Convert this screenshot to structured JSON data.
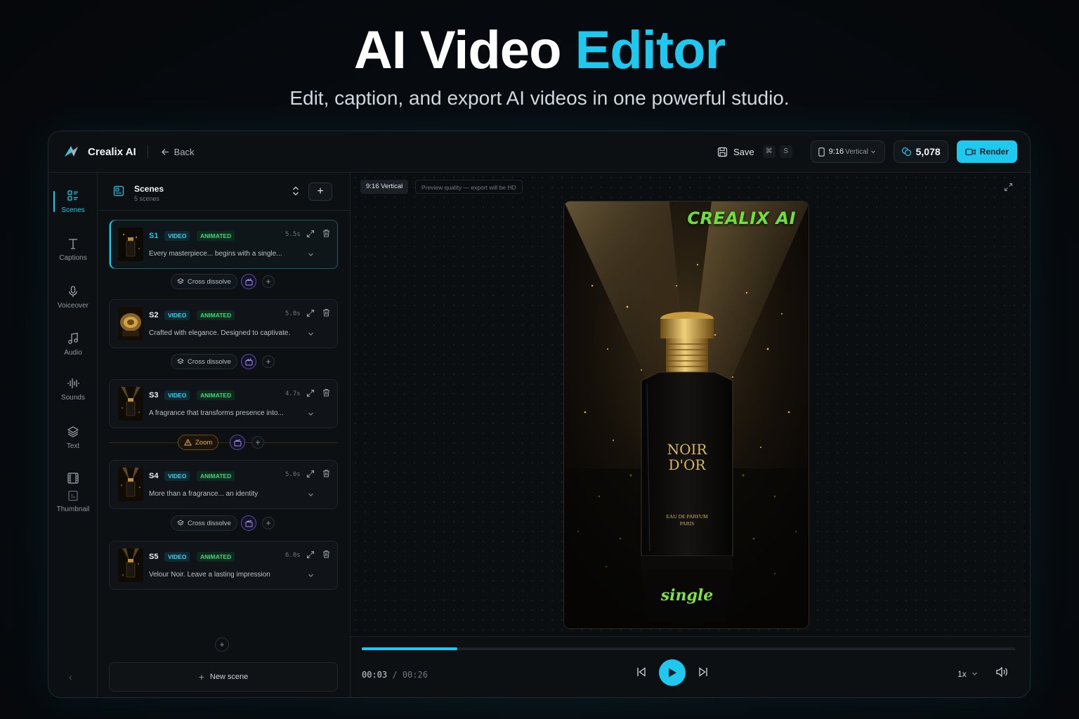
{
  "hero": {
    "title_main": "AI Video",
    "title_accent": "Editor",
    "subtitle": "Edit, caption, and export AI videos in one powerful studio."
  },
  "header": {
    "brand": "Crealix AI",
    "back": "Back",
    "save": "Save",
    "save_shortcut_mod": "⌘",
    "save_shortcut_key": "S",
    "aspect_ratio_value": "9:16",
    "aspect_ratio_label": "Vertical",
    "credits": "5,078",
    "render": "Render"
  },
  "rail": [
    {
      "label": "Scenes",
      "icon": "scenes-icon",
      "active": true
    },
    {
      "label": "Captions",
      "icon": "text-t-icon"
    },
    {
      "label": "Voiceover",
      "icon": "microphone-icon"
    },
    {
      "label": "Audio",
      "icon": "music-note-icon"
    },
    {
      "label": "Sounds",
      "icon": "waveform-icon"
    },
    {
      "label": "Text",
      "icon": "layers-icon"
    },
    {
      "label": "Thumbnail",
      "icon": "film-icon"
    }
  ],
  "scenes_panel": {
    "title": "Scenes",
    "count": "5 scenes",
    "scenes": [
      {
        "id": "S1",
        "tag_type": "VIDEO",
        "tag_status": "ANIMATED",
        "duration": "5.5s",
        "text": "Every masterpiece... begins with a single...",
        "active": true
      },
      {
        "id": "S2",
        "tag_type": "VIDEO",
        "tag_status": "ANIMATED",
        "duration": "5.0s",
        "text": "Crafted with elegance. Designed to captivate."
      },
      {
        "id": "S3",
        "tag_type": "VIDEO",
        "tag_status": "ANIMATED",
        "duration": "4.7s",
        "text": "A fragrance that transforms presence into..."
      },
      {
        "id": "S4",
        "tag_type": "VIDEO",
        "tag_status": "ANIMATED",
        "duration": "5.0s",
        "text": "More than a fragrance... an identity"
      },
      {
        "id": "S5",
        "tag_type": "VIDEO",
        "tag_status": "ANIMATED",
        "duration": "6.0s",
        "text": "Velour Noir. Leave a lasting impression"
      }
    ],
    "transitions": [
      {
        "label": "Cross dissolve",
        "warning": false
      },
      {
        "label": "Cross dissolve",
        "warning": false
      },
      {
        "label": "Zoom",
        "warning": true
      },
      {
        "label": "Cross dissolve",
        "warning": false
      }
    ],
    "new_scene": "New scene"
  },
  "preview": {
    "ratio_chip": "9:16 Vertical",
    "quality_chip": "Preview quality — export will be HD",
    "overlay_brand": "CREALIX AI",
    "overlay_caption": "single",
    "bottle_line1": "NOIR",
    "bottle_line2": "D'OR",
    "bottle_sub1": "EAU DE PARFUM",
    "bottle_sub2": "PARIS"
  },
  "player": {
    "current_time": "00:03",
    "separator": "/",
    "total_time": "00:26",
    "progress_fraction": 0.146,
    "speed": "1x"
  },
  "colors": {
    "accent": "#1ec8ee",
    "animated_tag": "#43d67f",
    "warning": "#f0b23a",
    "caption_green": "#7be43c"
  }
}
